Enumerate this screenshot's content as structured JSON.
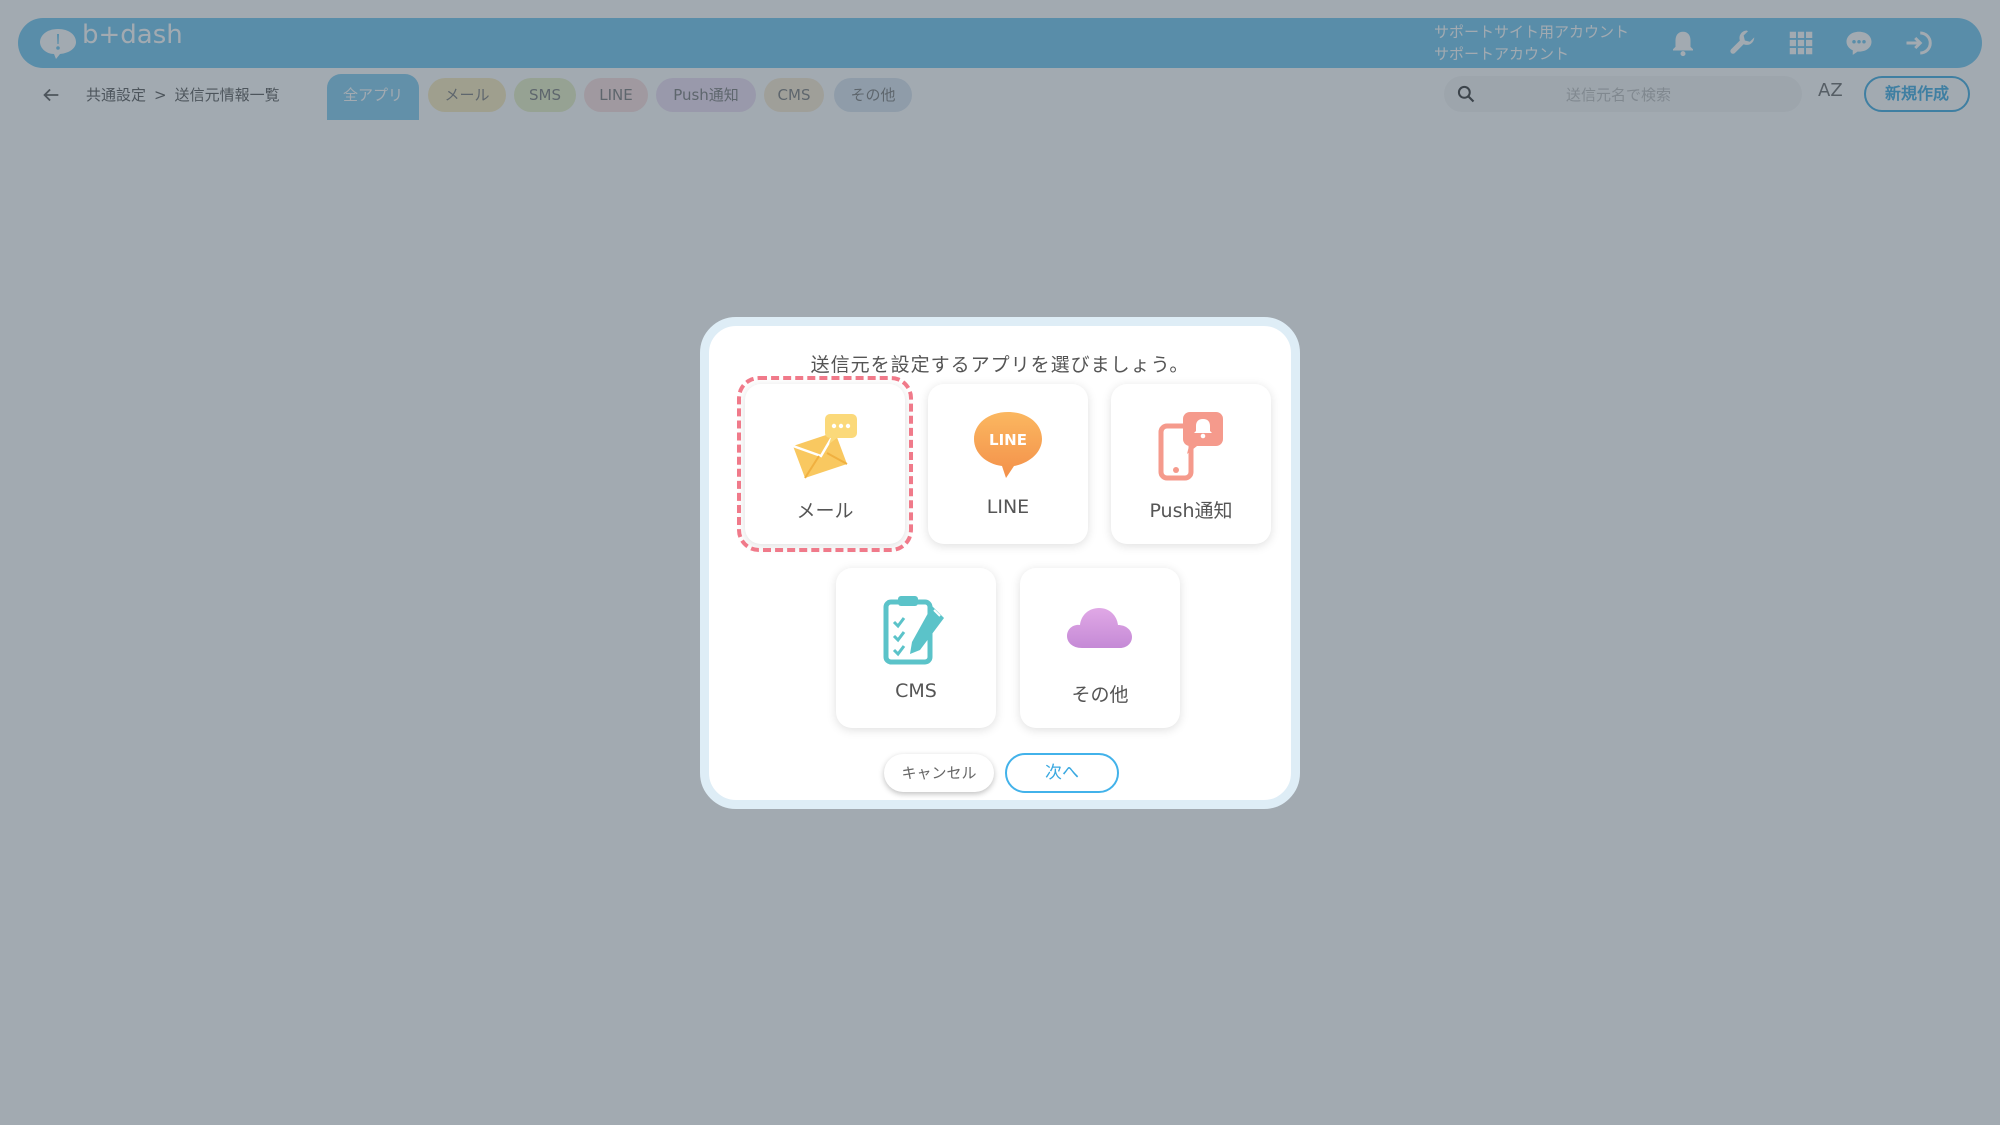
{
  "header": {
    "logo_text": "b+dash",
    "account_line1": "サポートサイト用アカウント",
    "account_line2": "サポートアカウント",
    "icons": [
      "bell-icon",
      "wrench-icon",
      "apps-grid-icon",
      "support-chat-icon",
      "logout-icon"
    ]
  },
  "subbar": {
    "breadcrumb": [
      "共通設定",
      "送信元情報一覧"
    ],
    "breadcrumb_separator": ">",
    "filter_tabs": [
      {
        "label": "全アプリ",
        "color": "#7fcaee"
      },
      {
        "label": "メール",
        "color": "#f9e8b8"
      },
      {
        "label": "SMS",
        "color": "#e6efc2"
      },
      {
        "label": "LINE",
        "color": "#fadcdc"
      },
      {
        "label": "Push通知",
        "color": "#ecdcf2"
      },
      {
        "label": "CMS",
        "color": "#f9e8cf"
      },
      {
        "label": "その他",
        "color": "#d8e3ef"
      }
    ],
    "search_placeholder": "送信元名で検索",
    "sort_label": "AZ",
    "new_button": "新規作成"
  },
  "modal": {
    "title": "送信元を設定するアプリを選びましょう。",
    "apps": [
      {
        "label": "メール",
        "icon": "mail-icon",
        "selected": true
      },
      {
        "label": "LINE",
        "icon": "line-icon",
        "selected": false
      },
      {
        "label": "Push通知",
        "icon": "push-notification-icon",
        "selected": false
      },
      {
        "label": "CMS",
        "icon": "cms-clipboard-icon",
        "selected": false
      },
      {
        "label": "その他",
        "icon": "cloud-icon",
        "selected": false
      }
    ],
    "line_logo_text": "LINE",
    "cancel_button": "キャンセル",
    "next_button": "次へ"
  },
  "colors": {
    "header_bg": "#6cc5ee",
    "accent": "#39a8e0",
    "selection_dash": "#f07a8a",
    "overlay": "rgba(70,85,100,0.5)"
  }
}
